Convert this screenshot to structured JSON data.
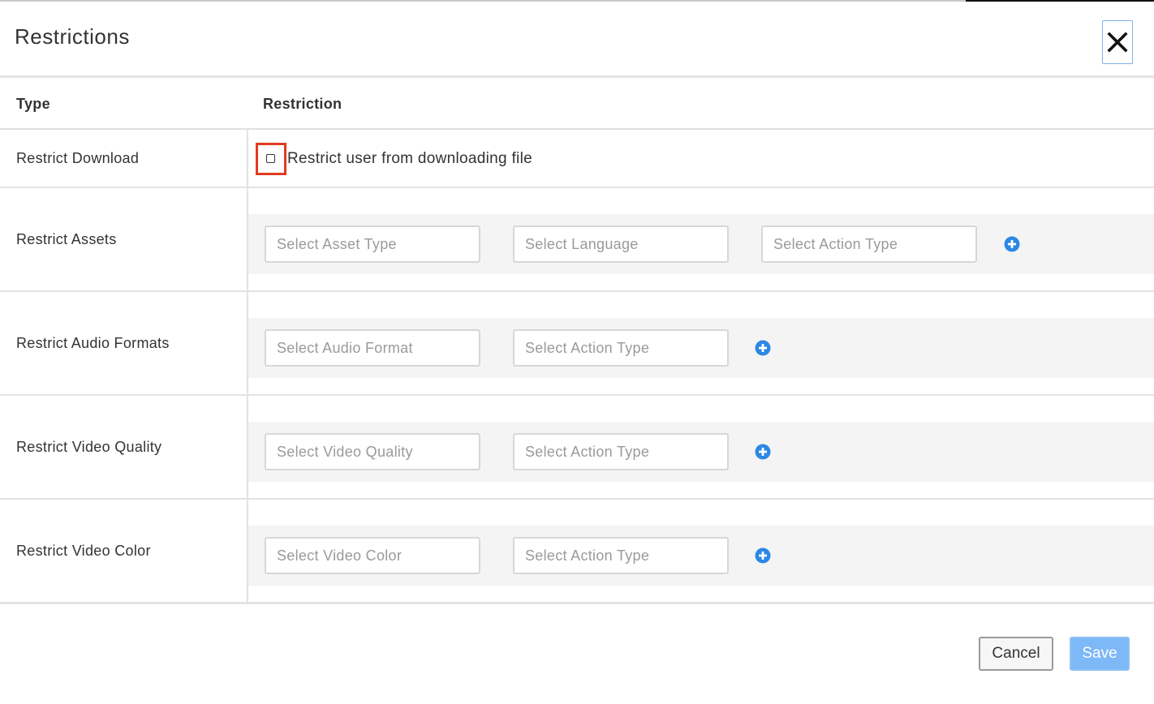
{
  "dialog": {
    "title": "Restrictions",
    "close_icon": "close-icon"
  },
  "table": {
    "headers": {
      "type": "Type",
      "restriction": "Restriction"
    },
    "rows": [
      {
        "type": "Restrict Download",
        "checkbox_label": "Restrict user from downloading file",
        "checked": false
      },
      {
        "type": "Restrict Assets",
        "selects": [
          "Select Asset Type",
          "Select Language",
          "Select Action Type"
        ]
      },
      {
        "type": "Restrict Audio Formats",
        "selects": [
          "Select Audio Format",
          "Select Action Type"
        ]
      },
      {
        "type": "Restrict Video Quality",
        "selects": [
          "Select Video Quality",
          "Select Action Type"
        ]
      },
      {
        "type": "Restrict Video Color",
        "selects": [
          "Select Video Color",
          "Select Action Type"
        ]
      }
    ]
  },
  "footer": {
    "cancel_label": "Cancel",
    "save_label": "Save"
  },
  "colors": {
    "accent": "#2b88e5",
    "save_button": "#7db8f7",
    "highlight": "#e23a1f"
  }
}
